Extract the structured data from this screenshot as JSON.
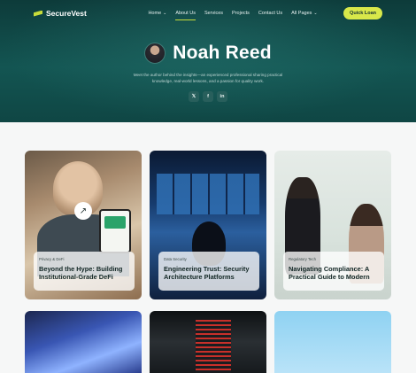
{
  "brand": {
    "name": "SecureVest"
  },
  "nav": {
    "items": [
      {
        "label": "Home",
        "chevron": true
      },
      {
        "label": "About Us",
        "chevron": false,
        "active": true
      },
      {
        "label": "Services",
        "chevron": false
      },
      {
        "label": "Projects",
        "chevron": false
      },
      {
        "label": "Contact Us",
        "chevron": false
      },
      {
        "label": "All Pages",
        "chevron": true
      }
    ],
    "cta_label": "Quick Loan"
  },
  "author": {
    "name": "Noah Reed",
    "bio": "Meet the author behind the insights—an experienced professional sharing practical knowledge, real-world lessons, and a passion for quality work.",
    "socials": [
      {
        "icon": "x-icon",
        "glyph": "𝕏"
      },
      {
        "icon": "facebook-icon",
        "glyph": "f"
      },
      {
        "icon": "linkedin-icon",
        "glyph": "in"
      }
    ]
  },
  "posts": [
    {
      "category": "Privacy & DeFi",
      "title": "Beyond the Hype: Building Institutional-Grade DeFi"
    },
    {
      "category": "Data Security",
      "title": "Engineering Trust: Security Architecture Platforms"
    },
    {
      "category": "Regulatory Tech",
      "title": "Navigating Compliance: A Practical Guide to Modern"
    }
  ],
  "colors": {
    "hero": "#135552",
    "accent": "#d8e84a"
  }
}
